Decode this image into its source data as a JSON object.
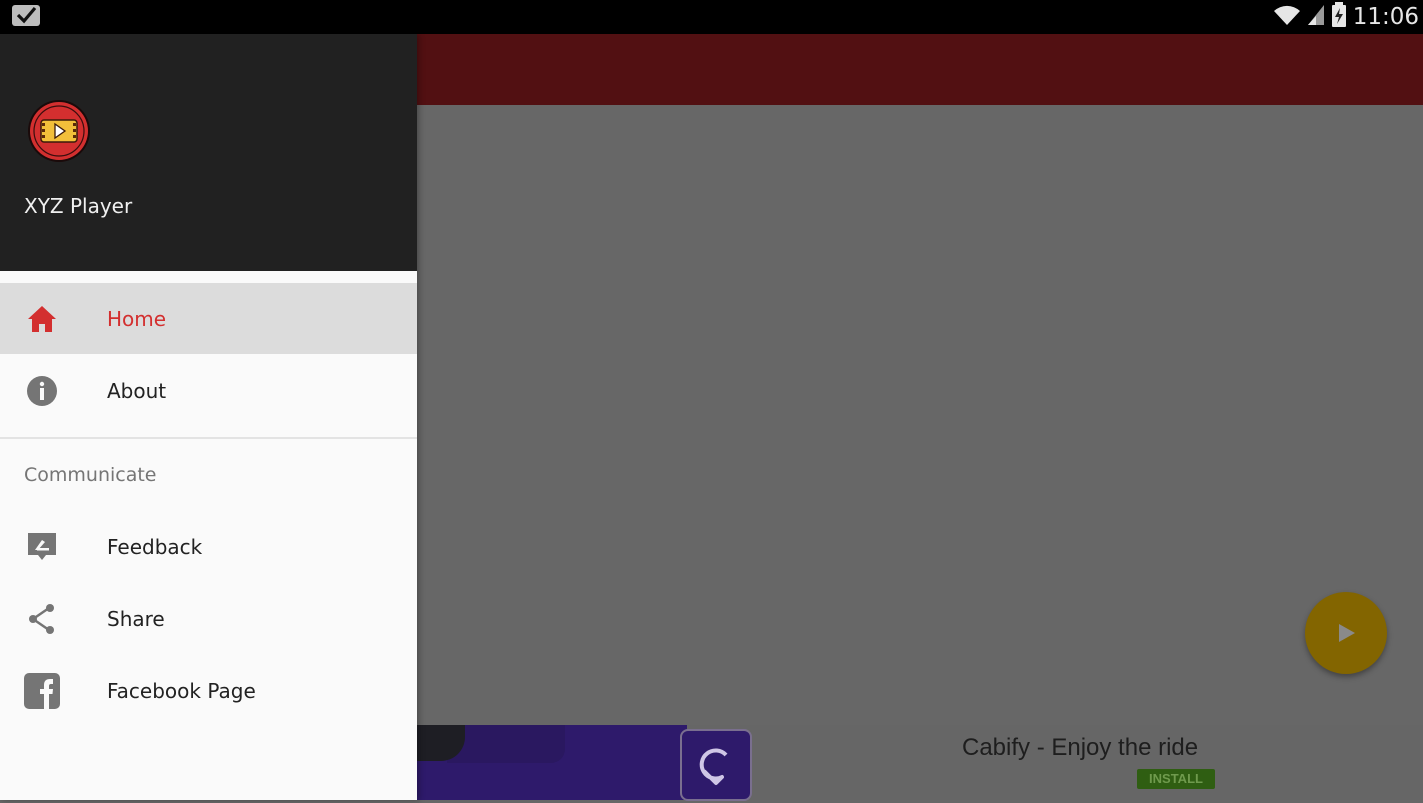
{
  "status_bar": {
    "notification_icon": "checkbox-notification-icon",
    "wifi_icon": "wifi-icon",
    "signal_icon": "signal-icon",
    "battery_icon": "battery-charging-icon",
    "time": "11:06"
  },
  "drawer": {
    "app_name": "XYZ Player",
    "logo_icon": "video-player-logo-icon",
    "items": [
      {
        "label": "Home",
        "icon": "home-icon",
        "active": true
      },
      {
        "label": "About",
        "icon": "info-icon",
        "active": false
      }
    ],
    "section_title": "Communicate",
    "section_items": [
      {
        "label": "Feedback",
        "icon": "feedback-icon"
      },
      {
        "label": "Share",
        "icon": "share-icon"
      },
      {
        "label": "Facebook Page",
        "icon": "facebook-icon"
      }
    ]
  },
  "colors": {
    "accent": "#d32f2f",
    "app_bar": "#521012",
    "drawer_header": "#212121",
    "fab": "#836500"
  },
  "main": {
    "fab_icon": "play-icon"
  },
  "ad": {
    "title": "Cabify - Enjoy the ride",
    "install_label": "INSTALL",
    "logo_icon": "cabify-logo-icon"
  }
}
